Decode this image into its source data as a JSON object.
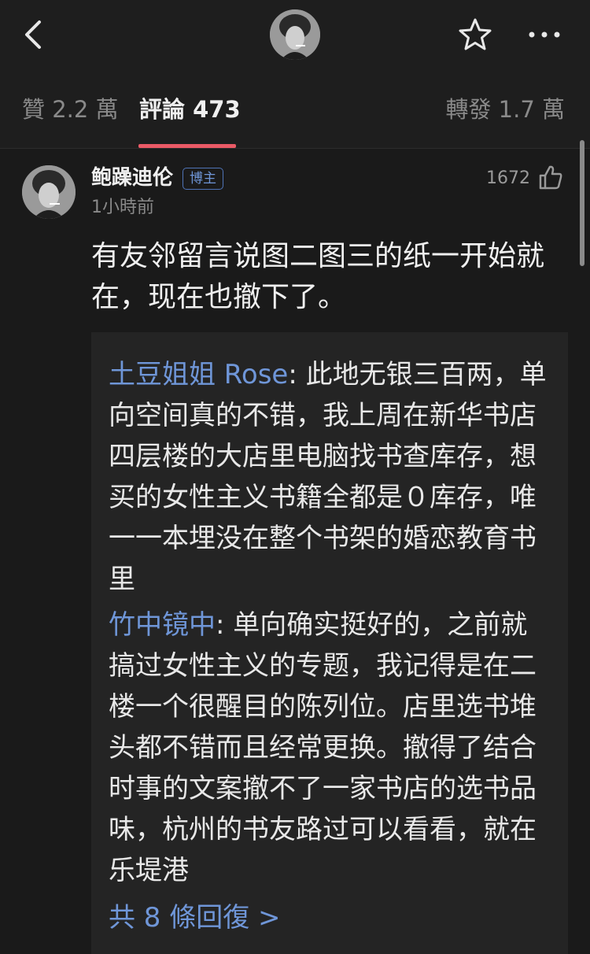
{
  "topbar": {
    "back_icon": "chevron-left-icon",
    "avatar": "user-avatar",
    "favorite_icon": "star-icon",
    "more_icon": "more-horizontal-icon"
  },
  "tabs": {
    "likes": "贊 2.2 萬",
    "comments": "評論 473",
    "reposts": "轉發 1.7 萬",
    "active": "comments",
    "indicator_color": "#ea5a66"
  },
  "comment": {
    "username": "鲍躁迪伦",
    "badge": "博主",
    "time": "1小時前",
    "likes": "1672",
    "like_icon": "thumbs-up-icon",
    "text": "有友邻留言说图二图三的纸一开始就在，现在也撤下了。"
  },
  "replies": [
    {
      "name": "土豆姐姐 Rose",
      "text": ": 此地无银三百两，单向空间真的不错，我上周在新华书店四层楼的大店里电脑找书查库存，想买的女性主义书籍全都是０库存，唯一一本埋没在整个书架的婚恋教育书里"
    },
    {
      "name": "竹中镜中",
      "text": ": 单向确实挺好的，之前就搞过女性主义的专题，我记得是在二楼一个很醒目的陈列位。店里选书堆头都不错而且经常更换。撤得了结合时事的文案撤不了一家书店的选书品味，杭州的书友路过可以看看，就在乐堤港"
    }
  ],
  "more_replies": "共 8 條回復 >",
  "colors": {
    "background": "#1a1a1a",
    "link": "#6f96d8",
    "reply_box": "#242424"
  }
}
